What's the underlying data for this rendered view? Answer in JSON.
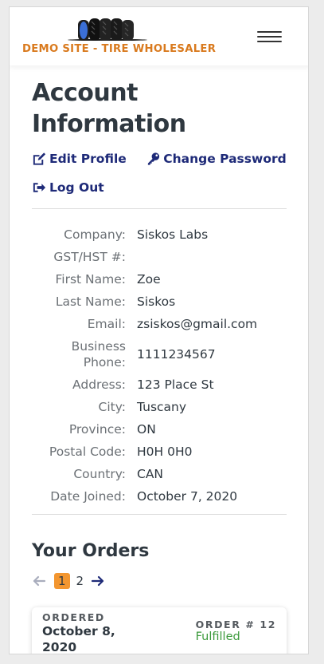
{
  "colors": {
    "brand_orange": "#d97a1e",
    "link_navy": "#1e2a78",
    "current_page_bg": "#f39630",
    "status_green": "#3c9a3c"
  },
  "header": {
    "logo_text": "DEMO SITE - TIRE WHOLESALER",
    "menu_icon": "hamburger-icon"
  },
  "account": {
    "title": "Account Information",
    "links": {
      "edit_profile": "Edit Profile",
      "edit_icon": "edit-icon",
      "change_password": "Change Password",
      "key_icon": "key-icon",
      "log_out": "Log Out",
      "logout_icon": "sign-out-icon"
    },
    "fields": [
      {
        "label": "Company:",
        "value": "Siskos Labs"
      },
      {
        "label": "GST/HST #:",
        "value": ""
      },
      {
        "label": "First Name:",
        "value": "Zoe"
      },
      {
        "label": "Last Name:",
        "value": "Siskos"
      },
      {
        "label": "Email:",
        "value": "zsiskos@gmail.com"
      },
      {
        "label": "Business Phone:",
        "value": "1111234567"
      },
      {
        "label": "Address:",
        "value": "123 Place St"
      },
      {
        "label": "City:",
        "value": "Tuscany"
      },
      {
        "label": "Province:",
        "value": "ON"
      },
      {
        "label": "Postal Code:",
        "value": "H0H 0H0"
      },
      {
        "label": "Country:",
        "value": "CAN"
      },
      {
        "label": "Date Joined:",
        "value": "October 7, 2020"
      }
    ]
  },
  "orders": {
    "title": "Your Orders",
    "pagination": {
      "prev_icon": "arrow-left-icon",
      "next_icon": "arrow-right-icon",
      "current_page": "1",
      "pages": [
        "1",
        "2"
      ]
    },
    "first_order": {
      "ordered_label": "ORDERED",
      "ordered_date": "October 8, 2020",
      "order_number": "ORDER # 12",
      "status": "Fulfilled"
    }
  }
}
